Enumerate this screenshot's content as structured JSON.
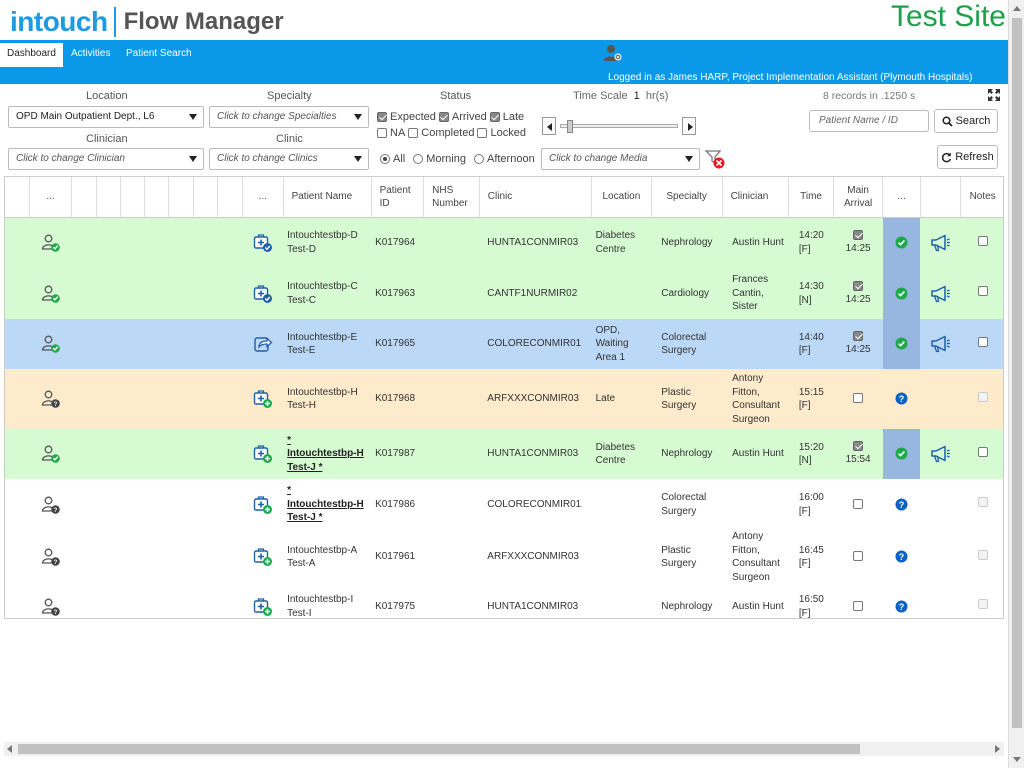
{
  "header": {
    "logo": "intouch",
    "product": "Flow Manager",
    "site": "Test Site"
  },
  "nav": {
    "tabs": [
      "Dashboard",
      "Activities",
      "Patient Search"
    ],
    "active_tab": "Dashboard",
    "login_info": "Logged in as James HARP, Project Implementation Assistant (Plymouth Hospitals)"
  },
  "filters": {
    "location_label": "Location",
    "location_value": "OPD Main Outpatient Dept., L6",
    "specialty_label": "Specialty",
    "specialty_value": "Click to change Specialties",
    "clinician_label": "Clinician",
    "clinician_value": "Click to change Clinician",
    "clinic_label": "Clinic",
    "clinic_value": "Click to change Clinics",
    "status_label": "Status",
    "status_options": {
      "expected": "Expected",
      "arrived": "Arrived",
      "late": "Late",
      "na": "NA",
      "completed": "Completed",
      "locked": "Locked"
    },
    "time_options": {
      "all": "All",
      "morning": "Morning",
      "afternoon": "Afternoon"
    },
    "timescale_label": "Time Scale",
    "timescale_value": "1",
    "timescale_unit": "hr(s)",
    "timescale_slider_fraction": 0.06,
    "media_value": "Click to change Media",
    "records_info": "8 records in .1250 s",
    "search_placeholder": "Patient Name / ID",
    "search_button": "Search",
    "refresh_button": "Refresh"
  },
  "columns": {
    "c1": "...",
    "c9": "...",
    "patient_name": "Patient Name",
    "patient_id": "Patient ID",
    "nhs_number": "NHS Number",
    "clinic": "Clinic",
    "location": "Location",
    "specialty": "Specialty",
    "clinician": "Clinician",
    "time": "Time",
    "main_arrival": "Main Arrival",
    "status": "...",
    "notes": "Notes"
  },
  "rows": [
    {
      "row_color": "green",
      "person_status": "arrived",
      "action_icon": "medkit-check-icon",
      "name": "Intouchtestbp-D Test-D",
      "name_link": false,
      "patient_id": "K017964",
      "nhs": "",
      "clinic": "HUNTA1CONMIR03",
      "location": "Diabetes Centre",
      "specialty": "Nephrology",
      "clinician": "Austin Hunt",
      "time": "14:20",
      "time_flag": "[F]",
      "arrived": true,
      "arrival_time": "14:25",
      "status_icon": "check",
      "megaphone": true,
      "notes_enabled": true
    },
    {
      "row_color": "green",
      "person_status": "arrived",
      "action_icon": "medkit-check-icon",
      "name": "Intouchtestbp-C Test-C",
      "name_link": false,
      "patient_id": "K017963",
      "nhs": "",
      "clinic": "CANTF1NURMIR02",
      "location": "",
      "specialty": "Cardiology",
      "clinician": "Frances Cantin, Sister",
      "time": "14:30",
      "time_flag": "[N]",
      "arrived": true,
      "arrival_time": "14:25",
      "status_icon": "check",
      "megaphone": true,
      "notes_enabled": true
    },
    {
      "row_color": "blue",
      "person_status": "arrived",
      "action_icon": "share-icon",
      "name": "Intouchtestbp-E Test-E",
      "name_link": false,
      "patient_id": "K017965",
      "nhs": "",
      "clinic": "COLORECONMIR01",
      "location": "OPD, Waiting Area 1",
      "specialty": "Colorectal Surgery",
      "clinician": "",
      "time": "14:40",
      "time_flag": "[F]",
      "arrived": true,
      "arrival_time": "14:25",
      "status_icon": "check",
      "megaphone": true,
      "notes_enabled": true
    },
    {
      "row_color": "orange",
      "person_status": "unknown",
      "action_icon": "medkit-plus-icon",
      "name": "Intouchtestbp-H Test-H",
      "name_link": false,
      "patient_id": "K017968",
      "nhs": "",
      "clinic": "ARFXXXCONMIR03",
      "location": "Late",
      "specialty": "Plastic Surgery",
      "clinician": "Antony Fitton, Consultant Surgeon",
      "time": "15:15",
      "time_flag": "[F]",
      "arrived": false,
      "arrival_time": "",
      "status_icon": "question",
      "megaphone": false,
      "notes_enabled": false
    },
    {
      "row_color": "green",
      "person_status": "arrived",
      "action_icon": "medkit-plus-icon",
      "name_prefix": "*",
      "name": "Intouchtestbp-H Test-J *",
      "name_link": true,
      "patient_id": "K017987",
      "nhs": "",
      "clinic": "HUNTA1CONMIR03",
      "location": "Diabetes Centre",
      "specialty": "Nephrology",
      "clinician": "Austin Hunt",
      "time": "15:20",
      "time_flag": "[N]",
      "arrived": true,
      "arrival_time": "15:54",
      "status_icon": "check",
      "megaphone": true,
      "notes_enabled": true
    },
    {
      "row_color": "white",
      "person_status": "unknown",
      "action_icon": "medkit-plus-icon",
      "name_prefix": "*",
      "name": "Intouchtestbp-H Test-J *",
      "name_link": true,
      "patient_id": "K017986",
      "nhs": "",
      "clinic": "COLORECONMIR01",
      "location": "",
      "specialty": "Colorectal Surgery",
      "clinician": "",
      "time": "16:00",
      "time_flag": "[F]",
      "arrived": false,
      "arrival_time": "",
      "status_icon": "question",
      "megaphone": false,
      "notes_enabled": false
    },
    {
      "row_color": "white",
      "person_status": "unknown",
      "action_icon": "medkit-plus-icon",
      "name": "Intouchtestbp-A Test-A",
      "name_link": false,
      "patient_id": "K017961",
      "nhs": "",
      "clinic": "ARFXXXCONMIR03",
      "location": "",
      "specialty": "Plastic Surgery",
      "clinician": "Antony Fitton, Consultant Surgeon",
      "time": "16:45",
      "time_flag": "[F]",
      "arrived": false,
      "arrival_time": "",
      "status_icon": "question",
      "megaphone": false,
      "notes_enabled": false
    },
    {
      "row_color": "white",
      "person_status": "unknown",
      "action_icon": "medkit-plus-icon",
      "name": "Intouchtestbp-I Test-I",
      "name_link": false,
      "patient_id": "K017975",
      "nhs": "",
      "clinic": "HUNTA1CONMIR03",
      "location": "",
      "specialty": "Nephrology",
      "clinician": "Austin Hunt",
      "time": "16:50",
      "time_flag": "[F]",
      "arrived": false,
      "arrival_time": "",
      "status_icon": "question",
      "megaphone": false,
      "notes_enabled": false
    }
  ],
  "colors": {
    "nav": "#0a99e8",
    "brand": "#1e9be0",
    "site": "#1ea04b",
    "row_green": "#d6fbd2",
    "row_blue": "#bcd8f7",
    "row_orange": "#feebcc",
    "status_col": "#97b7e0",
    "check_green": "#1fa84a",
    "question_blue": "#0b62c4"
  }
}
